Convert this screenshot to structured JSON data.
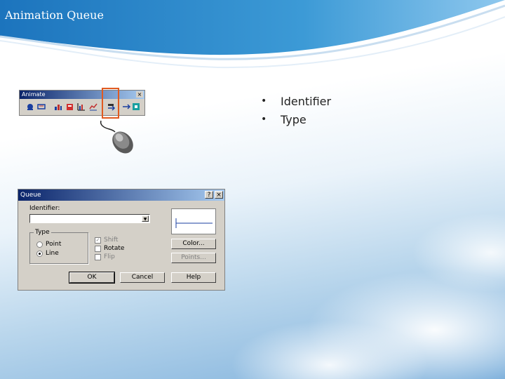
{
  "slide": {
    "title": "Animation Queue",
    "bullets": [
      "Identifier",
      "Type"
    ],
    "bullet_glyph": "•"
  },
  "colors": {
    "header_blue": "#2a86c8",
    "highlight_box": "#e05a20",
    "titlebar": "#0a246a"
  },
  "animate_toolbar": {
    "title": "Animate",
    "close_glyph": "×",
    "icons": [
      "animate-icon",
      "animate-icon-2",
      "bar-icon",
      "pie-icon",
      "graph-icon",
      "line-icon",
      "queue-icon",
      "move-icon",
      "stop-icon"
    ],
    "highlighted_icon": "queue-icon"
  },
  "queue_dialog": {
    "title": "Queue",
    "help_glyph": "?",
    "close_glyph": "×",
    "identifier_label": "Identifier:",
    "identifier_value": "",
    "type_group_label": "Type",
    "type_options": [
      "Point",
      "Line"
    ],
    "type_selected": "Line",
    "checkboxes": [
      {
        "label": "Shift",
        "checked": true,
        "enabled": false
      },
      {
        "label": "Rotate",
        "checked": false,
        "enabled": true
      },
      {
        "label": "Flip",
        "checked": false,
        "enabled": false
      }
    ],
    "buttons": {
      "color": "Color...",
      "points": "Points...",
      "ok": "OK",
      "cancel": "Cancel",
      "help": "Help"
    }
  }
}
